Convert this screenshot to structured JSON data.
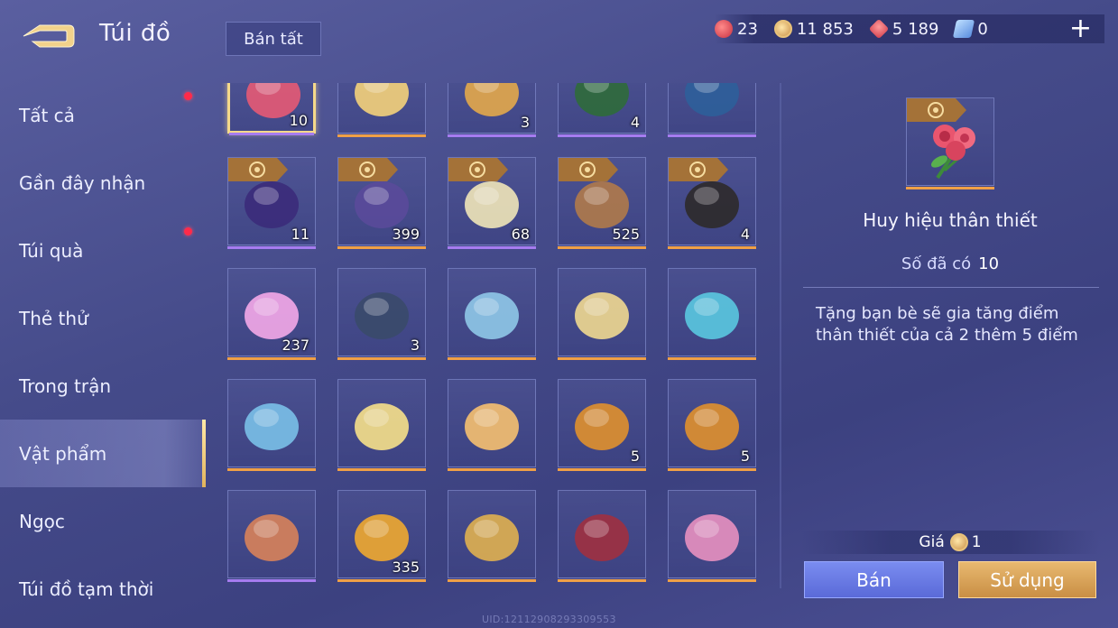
{
  "header": {
    "title": "Túi đồ",
    "sell_all_label": "Bán tất",
    "currencies": [
      {
        "icon": "red-voucher-icon",
        "value": "23",
        "color": "#d8484e"
      },
      {
        "icon": "gold-coin-icon",
        "value": "11 853",
        "color": "#d9a95a"
      },
      {
        "icon": "ruby-icon",
        "value": "5 189",
        "color": "#e2595a"
      },
      {
        "icon": "diamond-card-icon",
        "value": "0",
        "color": "#6fa8f0"
      }
    ],
    "add_label": "+"
  },
  "sidebar": {
    "items": [
      {
        "label": "Tất cả",
        "badge": true
      },
      {
        "label": "Gần đây nhận",
        "badge": false
      },
      {
        "label": "Túi quà",
        "badge": true
      },
      {
        "label": "Thẻ thử",
        "badge": false
      },
      {
        "label": "Trong trận",
        "badge": false
      },
      {
        "label": "Vật phẩm",
        "badge": false,
        "active": true
      },
      {
        "label": "Ngọc",
        "badge": false
      },
      {
        "label": "Túi đồ tạm thời",
        "badge": false
      }
    ]
  },
  "grid": {
    "rows": [
      [
        {
          "icon": "rose-bouquet-icon",
          "qty": "10",
          "bar": "purple",
          "selected": true
        },
        {
          "icon": "gold-star-badge-icon",
          "qty": "",
          "bar": "orange"
        },
        {
          "icon": "golden-key-icon",
          "qty": "3",
          "bar": "purple"
        },
        {
          "icon": "gold-x2-card-icon",
          "qty": "4",
          "bar": "purple"
        },
        {
          "icon": "exp-x2-card-icon",
          "qty": "",
          "bar": "purple"
        }
      ],
      [
        {
          "icon": "purple-flag-card-icon",
          "qty": "11",
          "bar": "purple",
          "tag": true
        },
        {
          "icon": "knight-helmet-icon",
          "qty": "399",
          "bar": "orange",
          "tag": true
        },
        {
          "icon": "glowing-orb-icon",
          "qty": "68",
          "bar": "purple",
          "tag": true
        },
        {
          "icon": "stone-golem-icon",
          "qty": "525",
          "bar": "orange",
          "tag": true
        },
        {
          "icon": "tap-check-coin-icon",
          "qty": "4",
          "bar": "orange",
          "tag": true
        }
      ],
      [
        {
          "icon": "crystal-star-icon",
          "qty": "237",
          "bar": "orange"
        },
        {
          "icon": "scroll-map-icon",
          "qty": "3",
          "bar": "orange"
        },
        {
          "icon": "flower-platter-icon",
          "qty": "",
          "bar": "orange"
        },
        {
          "icon": "fruit-bowl-icon",
          "qty": "",
          "bar": "orange"
        },
        {
          "icon": "jelly-dish-icon",
          "qty": "",
          "bar": "orange"
        }
      ],
      [
        {
          "icon": "star-platter-icon",
          "qty": "",
          "bar": "orange"
        },
        {
          "icon": "cake-slice-icon",
          "qty": "",
          "bar": "orange"
        },
        {
          "icon": "cat-dumpling-icon",
          "qty": "",
          "bar": "orange"
        },
        {
          "icon": "hero-shard-icon",
          "qty": "5",
          "bar": "orange"
        },
        {
          "icon": "hero-shard-2-icon",
          "qty": "5",
          "bar": "orange"
        }
      ],
      [
        {
          "icon": "amber-crystal-icon",
          "qty": "",
          "bar": "purple"
        },
        {
          "icon": "golden-ticket-icon",
          "qty": "335",
          "bar": "orange"
        },
        {
          "icon": "trophy-cup-icon",
          "qty": "",
          "bar": "orange"
        },
        {
          "icon": "planet-ring-icon",
          "qty": "",
          "bar": "orange"
        },
        {
          "icon": "chibi-hero-icon",
          "qty": "",
          "bar": "orange"
        }
      ]
    ]
  },
  "detail": {
    "icon": "rose-bouquet-icon",
    "name": "Huy hiệu thân thiết",
    "owned_label": "Số đã có",
    "owned_value": "10",
    "description": "Tặng bạn bè sẽ gia tăng điểm thân thiết của cả 2 thêm 5 điểm",
    "price_label": "Giá",
    "price_value": "1",
    "sell_label": "Bán",
    "use_label": "Sử dụng"
  },
  "footer": {
    "uid": "UID:12112908293309553"
  }
}
